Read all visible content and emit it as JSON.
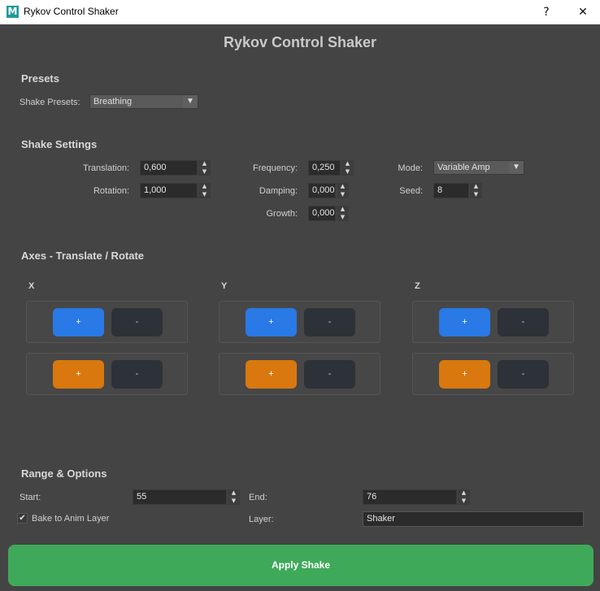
{
  "window": {
    "icon_letter": "M",
    "title": "Rykov Control Shaker",
    "help_glyph": "?",
    "close_glyph": "✕"
  },
  "header": {
    "title": "Rykov Control Shaker"
  },
  "presets": {
    "section_title": "Presets",
    "label": "Shake Presets:",
    "value": "Breathing"
  },
  "shake_settings": {
    "section_title": "Shake Settings",
    "translation": {
      "label": "Translation:",
      "value": "0,600"
    },
    "rotation": {
      "label": "Rotation:",
      "value": "1,000"
    },
    "frequency": {
      "label": "Frequency:",
      "value": "0,250"
    },
    "damping": {
      "label": "Damping:",
      "value": "0,000"
    },
    "growth": {
      "label": "Growth:",
      "value": "0,000"
    },
    "mode": {
      "label": "Mode:",
      "value": "Variable Amp"
    },
    "seed": {
      "label": "Seed:",
      "value": "8"
    }
  },
  "axes": {
    "section_title": "Axes - Translate / Rotate",
    "x": {
      "label": "X"
    },
    "y": {
      "label": "Y"
    },
    "z": {
      "label": "Z"
    },
    "plus": "+",
    "minus": "-"
  },
  "range": {
    "section_title": "Range & Options",
    "start": {
      "label": "Start:",
      "value": "55"
    },
    "end": {
      "label": "End:",
      "value": "76"
    },
    "bake": {
      "label": "Bake to Anim Layer",
      "checked": true,
      "check_glyph": "✔"
    },
    "layer": {
      "label": "Layer:",
      "value": "Shaker"
    }
  },
  "apply": {
    "label": "Apply Shake"
  },
  "colors": {
    "translate_accent": "#2979e6",
    "rotate_accent": "#d9780e",
    "apply": "#3fa95a",
    "background": "#444444"
  }
}
